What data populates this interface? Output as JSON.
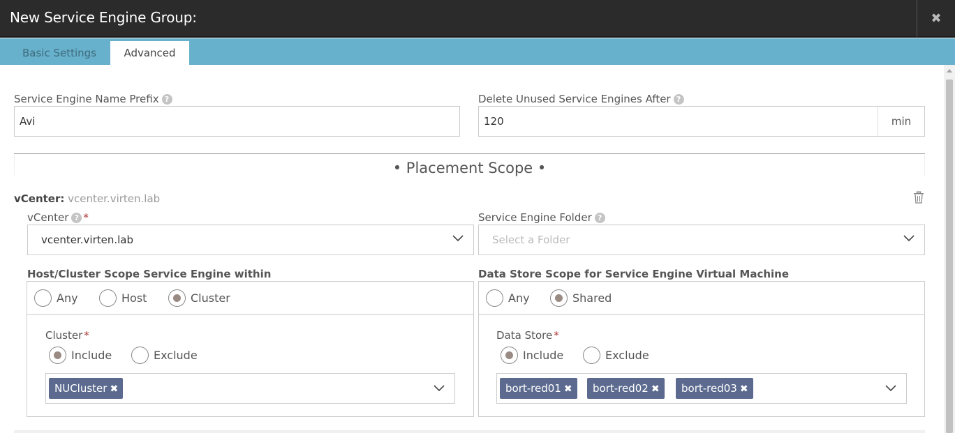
{
  "window": {
    "title": "New Service Engine Group:",
    "close_glyph": "✖"
  },
  "tabs": [
    {
      "label": "Basic Settings",
      "active": false
    },
    {
      "label": "Advanced",
      "active": true
    }
  ],
  "fields": {
    "prefix": {
      "label": "Service Engine Name Prefix",
      "value": "Avi"
    },
    "delete_after": {
      "label": "Delete Unused Service Engines After",
      "value": "120",
      "unit": "min"
    }
  },
  "placement": {
    "title": "• Placement Scope •",
    "vcenter_prefix": "vCenter:",
    "vcenter_name": "vcenter.virten.lab",
    "vcenter_label": "vCenter",
    "vcenter_value": "vcenter.virten.lab",
    "folder_label": "Service Engine Folder",
    "folder_placeholder": "Select a Folder"
  },
  "host_scope": {
    "label": "Host/Cluster Scope Service Engine within",
    "options": [
      "Any",
      "Host",
      "Cluster"
    ],
    "selected": "Cluster",
    "cluster_label": "Cluster",
    "filter_options": [
      "Include",
      "Exclude"
    ],
    "filter_selected": "Include",
    "tags": [
      "NUCluster"
    ]
  },
  "datastore_scope": {
    "label": "Data Store Scope for Service Engine Virtual Machine",
    "options": [
      "Any",
      "Shared"
    ],
    "selected": "Shared",
    "datastore_label": "Data Store",
    "filter_options": [
      "Include",
      "Exclude"
    ],
    "filter_selected": "Include",
    "tags": [
      "bort-red01",
      "bort-red02",
      "bort-red03"
    ]
  },
  "required_marker": "*",
  "help_glyph": "?",
  "tag_remove_glyph": "✖",
  "colors": {
    "titlebar": "#2b2b2b",
    "tabbar": "#67b1cc",
    "tag": "#5b6a8e",
    "radio_fill": "#9a8a84",
    "required": "#aa3333"
  }
}
